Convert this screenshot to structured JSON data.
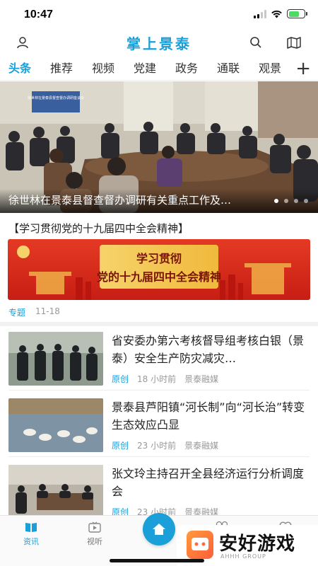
{
  "status": {
    "time": "10:47"
  },
  "header": {
    "title": "掌上景泰"
  },
  "tabs": [
    "头条",
    "推荐",
    "视频",
    "党建",
    "政务",
    "通联",
    "观景"
  ],
  "hero": {
    "title": "徐世林在景泰县督查督办调研有关重点工作及…",
    "slide_count": 4,
    "active_slide": 1,
    "sign_text": "徐世林在景泰县督查督办调研座谈会"
  },
  "feature": {
    "section_title": "【学习贯彻党的十九届四中全会精神】",
    "banner_line1": "学习贯彻",
    "banner_line2": "党的十九届四中全会精神",
    "tag": "专题",
    "date": "11-18"
  },
  "news": [
    {
      "title": "省安委办第六考核督导组考核白银（景泰）安全生产防灾减灾…",
      "tag": "原创",
      "time": "18 小时前",
      "source": "景泰融媒"
    },
    {
      "title": "景泰县芦阳镇“河长制”向“河长治”转变生态效应凸显",
      "tag": "原创",
      "time": "23 小时前",
      "source": "景泰融媒"
    },
    {
      "title": "张文玲主持召开全县经济运行分析调度会",
      "tag": "原创",
      "time": "23 小时前",
      "source": "景泰融媒"
    }
  ],
  "bottom_nav": [
    {
      "label": "资讯",
      "icon": "news-icon"
    },
    {
      "label": "视听",
      "icon": "video-icon"
    },
    {
      "label": "",
      "icon": "home-icon"
    },
    {
      "label": "",
      "icon": "grid-icon"
    },
    {
      "label": "",
      "icon": "heart-icon"
    }
  ],
  "watermark": {
    "text": "安好游戏",
    "sub": "AHHH GROUP"
  },
  "colors": {
    "accent": "#1a9fd9",
    "banner_red": "#d8261c",
    "banner_gold": "#f3c64d"
  }
}
